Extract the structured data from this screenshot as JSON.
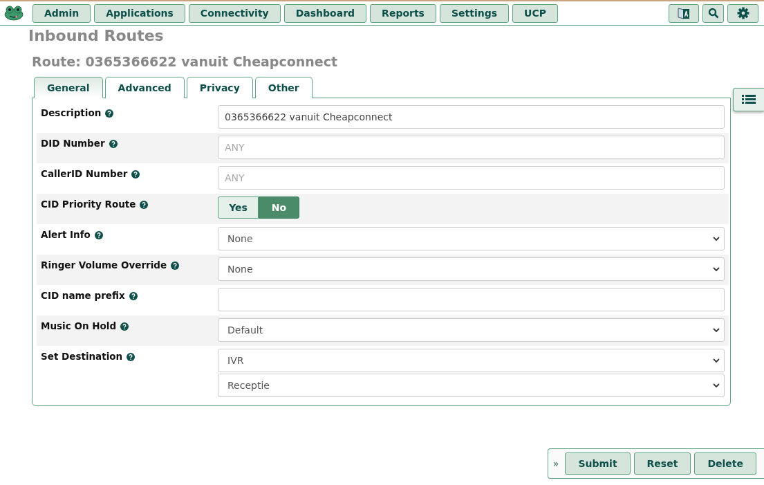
{
  "nav": {
    "items": [
      "Admin",
      "Applications",
      "Connectivity",
      "Dashboard",
      "Reports",
      "Settings",
      "UCP"
    ]
  },
  "page_title": "Inbound Routes",
  "route_heading": "Route: 0365366622 vanuit Cheapconnect",
  "tabs": [
    {
      "label": "General",
      "selected": true
    },
    {
      "label": "Advanced",
      "selected": false
    },
    {
      "label": "Privacy",
      "selected": false
    },
    {
      "label": "Other",
      "selected": false
    }
  ],
  "form_rows": [
    {
      "label": "Description",
      "kind": "text",
      "value": "0365366622 vanuit Cheapconnect"
    },
    {
      "label": "DID Number",
      "kind": "text",
      "placeholder": "ANY"
    },
    {
      "label": "CallerID Number",
      "kind": "text",
      "placeholder": "ANY"
    },
    {
      "label": "CID Priority Route",
      "kind": "toggle",
      "options": [
        {
          "label": "Yes",
          "selected": false
        },
        {
          "label": "No",
          "selected": true
        }
      ]
    },
    {
      "label": "Alert Info",
      "kind": "select",
      "values": [
        "None"
      ]
    },
    {
      "label": "Ringer Volume Override",
      "kind": "select",
      "values": [
        "None"
      ]
    },
    {
      "label": "CID name prefix",
      "kind": "text"
    },
    {
      "label": "Music On Hold",
      "kind": "select",
      "values": [
        "Default"
      ]
    },
    {
      "label": "Set Destination",
      "kind": "select",
      "values": [
        "IVR",
        "Receptie"
      ]
    }
  ],
  "action_bar": {
    "collapse": "»",
    "buttons": [
      "Submit",
      "Reset",
      "Delete"
    ]
  }
}
